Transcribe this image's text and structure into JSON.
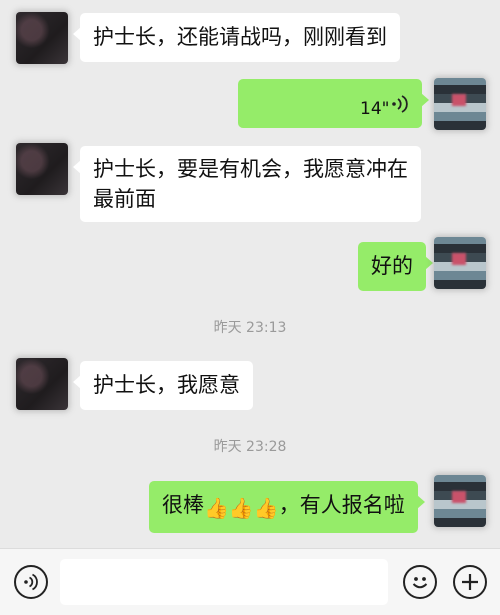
{
  "messages": {
    "m1": {
      "text": "护士长，还能请战吗，刚刚看到"
    },
    "m2": {
      "voice_duration": "14\""
    },
    "m3": {
      "line1": "护士长，要是有机会，我愿意冲在",
      "line2": "最前面"
    },
    "m4": {
      "text": "好的"
    },
    "m5": {
      "text": "护士长，我愿意"
    },
    "m6": {
      "prefix": "很棒",
      "suffix": "，有人报名啦",
      "emoji": "👍"
    }
  },
  "timestamps": {
    "t1": "昨天 23:13",
    "t2": "昨天 23:28"
  },
  "bottom_bar": {
    "voice_icon": "voice-mode-icon",
    "emoji_icon": "smiley-icon",
    "plus_icon": "plus-icon"
  },
  "colors": {
    "sent_bubble": "#95ec69",
    "received_bubble": "#ffffff",
    "background": "#ebebeb"
  }
}
